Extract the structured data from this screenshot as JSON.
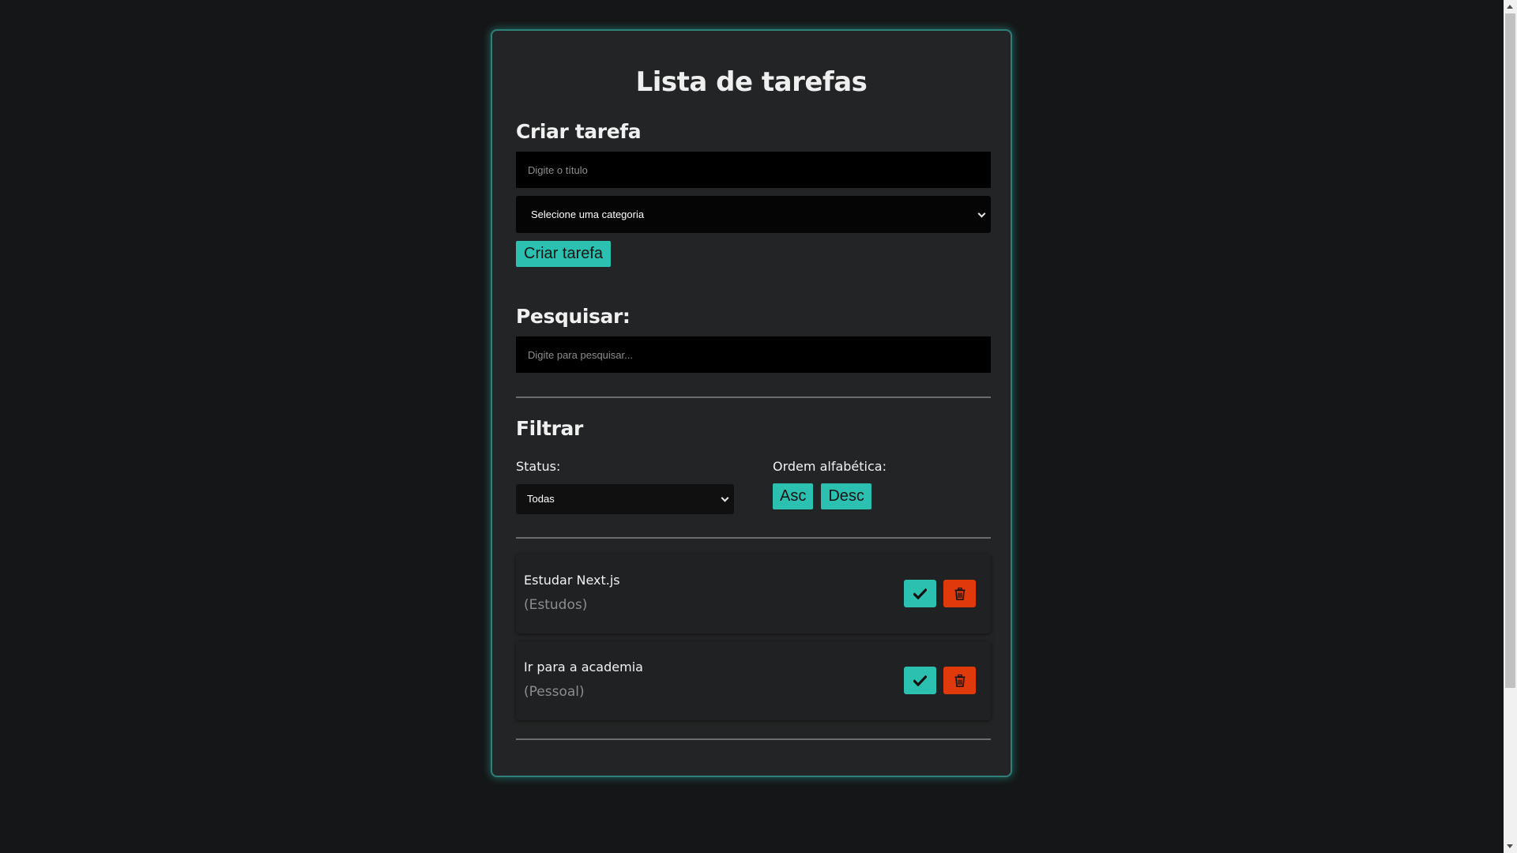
{
  "app": {
    "title": "Lista de tarefas"
  },
  "create": {
    "heading": "Criar tarefa",
    "title_placeholder": "Digite o título",
    "category_selected": "Selecione uma categoria",
    "button_label": "Criar tarefa"
  },
  "search": {
    "heading": "Pesquisar:",
    "placeholder": "Digite para pesquisar..."
  },
  "filter": {
    "heading": "Filtrar",
    "status_label": "Status:",
    "status_selected": "Todas",
    "sort_label": "Ordem alfabética:",
    "sort_asc": "Asc",
    "sort_desc": "Desc"
  },
  "tasks": [
    {
      "title": "Estudar Next.js",
      "category": "(Estudos)"
    },
    {
      "title": "Ir para a academia",
      "category": "(Pessoal)"
    }
  ],
  "icons": {
    "complete": "check-icon",
    "delete": "trash-icon",
    "dropdown": "chevron-down-icon"
  },
  "colors": {
    "accent": "#2cc0b0",
    "danger": "#e03a0c",
    "background": "#151617",
    "card": "#232425",
    "card_border": "#2f7f78"
  }
}
